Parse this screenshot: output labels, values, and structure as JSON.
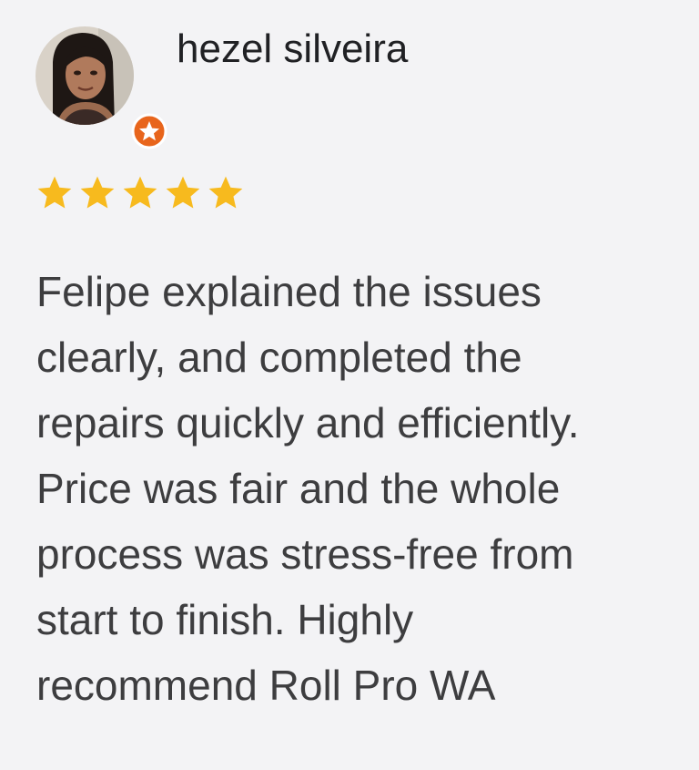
{
  "reviewer": {
    "name": "hezel silveira",
    "avatar_icon": "reviewer-photo",
    "badge_icon": "local-guide-star-icon",
    "badge_color": "#e8651c"
  },
  "rating": {
    "value": 5,
    "max": 5,
    "star_color": "#f7ba1e"
  },
  "review": {
    "lines": [
      "Felipe explained the issues",
      "clearly, and completed the",
      "repairs quickly and efficiently.",
      "Price was fair and the whole",
      "process was stress-free from",
      "start to finish. Highly",
      "recommend Roll Pro WA"
    ]
  }
}
